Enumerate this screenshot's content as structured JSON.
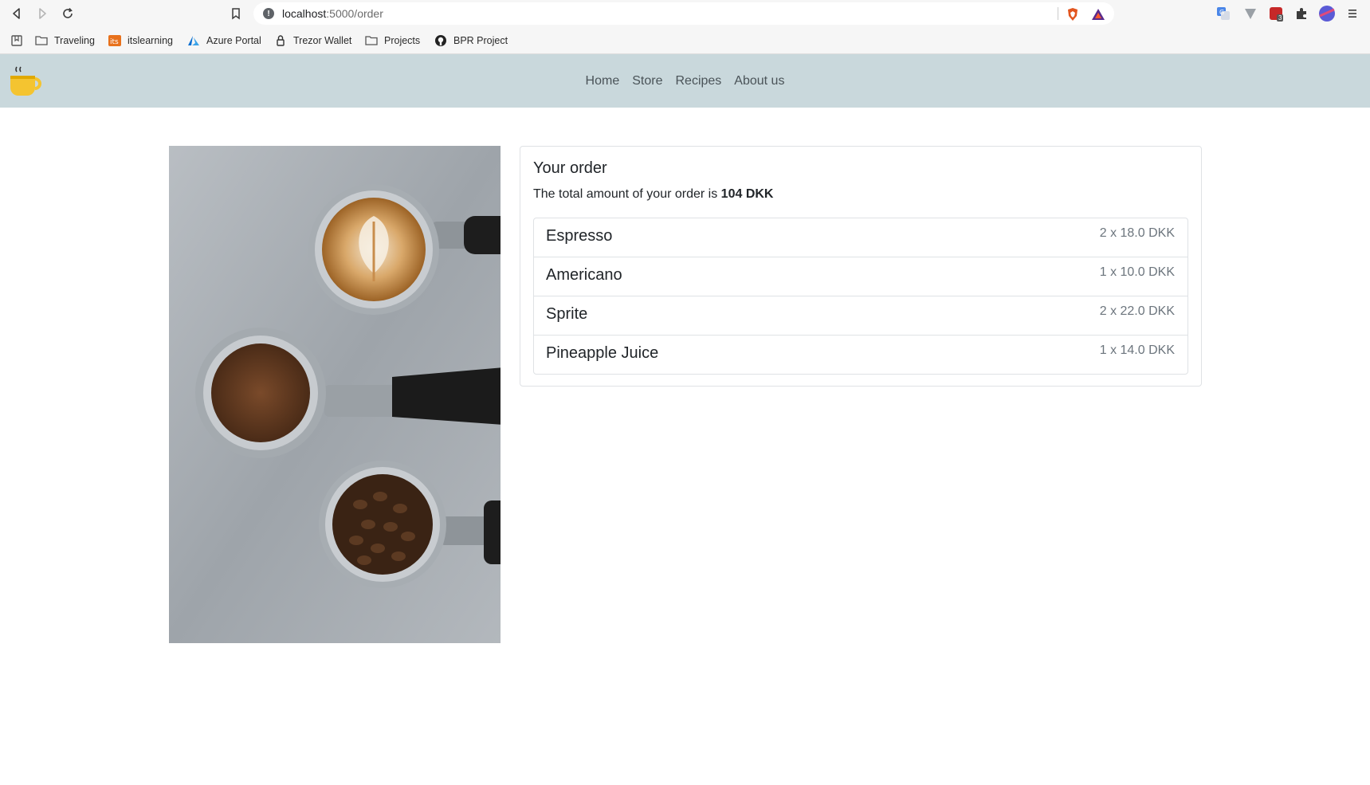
{
  "browser": {
    "url_host": "localhost",
    "url_path": ":5000/order",
    "bookmarks": [
      {
        "label": "Traveling",
        "icon": "folder-icon"
      },
      {
        "label": "itslearning",
        "icon": "itslearning-icon"
      },
      {
        "label": "Azure Portal",
        "icon": "azure-icon"
      },
      {
        "label": "Trezor Wallet",
        "icon": "lock-icon"
      },
      {
        "label": "Projects",
        "icon": "folder-icon"
      },
      {
        "label": "BPR Project",
        "icon": "github-icon"
      }
    ],
    "extension_badge": "3"
  },
  "nav": {
    "links": [
      "Home",
      "Store",
      "Recipes",
      "About us"
    ]
  },
  "order": {
    "title": "Your order",
    "total_prefix": "The total amount of your order is ",
    "total_value": "104 DKK",
    "items": [
      {
        "name": "Espresso",
        "price": "2 x 18.0 DKK"
      },
      {
        "name": "Americano",
        "price": "1 x 10.0 DKK"
      },
      {
        "name": "Sprite",
        "price": "2 x 22.0 DKK"
      },
      {
        "name": "Pineapple Juice",
        "price": "1 x 14.0 DKK"
      }
    ]
  },
  "colors": {
    "nav_bg": "#c9d8dc",
    "border": "#dfe2e5",
    "muted": "#6c757d"
  }
}
